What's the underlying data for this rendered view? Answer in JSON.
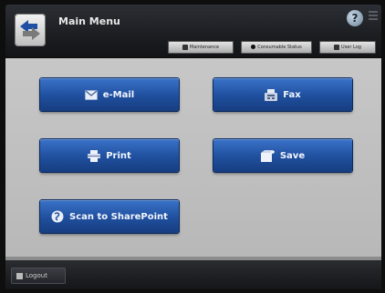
{
  "header": {
    "title": "Main Menu",
    "help_label": "?",
    "tools": [
      {
        "label": "Maintenance",
        "icon": "wrench-icon"
      },
      {
        "label": "Consumable Status",
        "icon": "circle-icon"
      },
      {
        "label": "User Log",
        "icon": "log-icon"
      }
    ]
  },
  "menu": {
    "email_label": "e-Mail",
    "fax_label": "Fax",
    "print_label": "Print",
    "save_label": "Save",
    "sharepoint_label": "Scan to SharePoint"
  },
  "footer": {
    "logout_label": "Logout"
  },
  "colors": {
    "accent_blue": "#1f4f9d",
    "panel_gray": "#c0c0c0",
    "header_dark": "#1b1d21"
  }
}
